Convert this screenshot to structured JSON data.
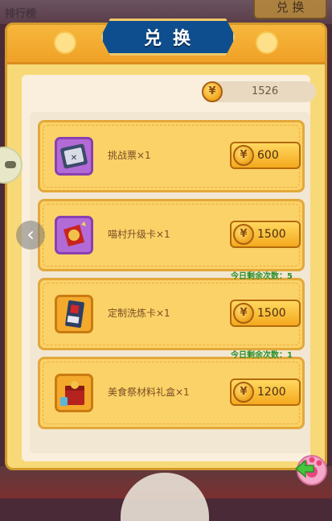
{
  "background": {
    "top_button_label": "兑 换",
    "top_left_text": "排行榜"
  },
  "dialog": {
    "title": "兑换"
  },
  "balance": {
    "value": "1526",
    "coin_icon": "coin-icon"
  },
  "items": [
    {
      "name": "挑战票×1",
      "price": "600",
      "limit": "",
      "frame": "purple",
      "icon": "ticket-icon"
    },
    {
      "name": "喵村升级卡×1",
      "price": "1500",
      "limit": "",
      "frame": "purple",
      "icon": "upgrade-card-icon"
    },
    {
      "name": "定制洗炼卡×1",
      "price": "1500",
      "limit": "今日剩余次数：5",
      "frame": "gold",
      "icon": "refine-card-icon"
    },
    {
      "name": "美食祭材料礼盒×1",
      "price": "1200",
      "limit": "今日剩余次数：1",
      "frame": "gold",
      "icon": "gift-box-icon"
    }
  ],
  "colors": {
    "panel": "#f8d978",
    "title_plate": "#0f4e8e",
    "limit_text": "#2c8f2a"
  }
}
